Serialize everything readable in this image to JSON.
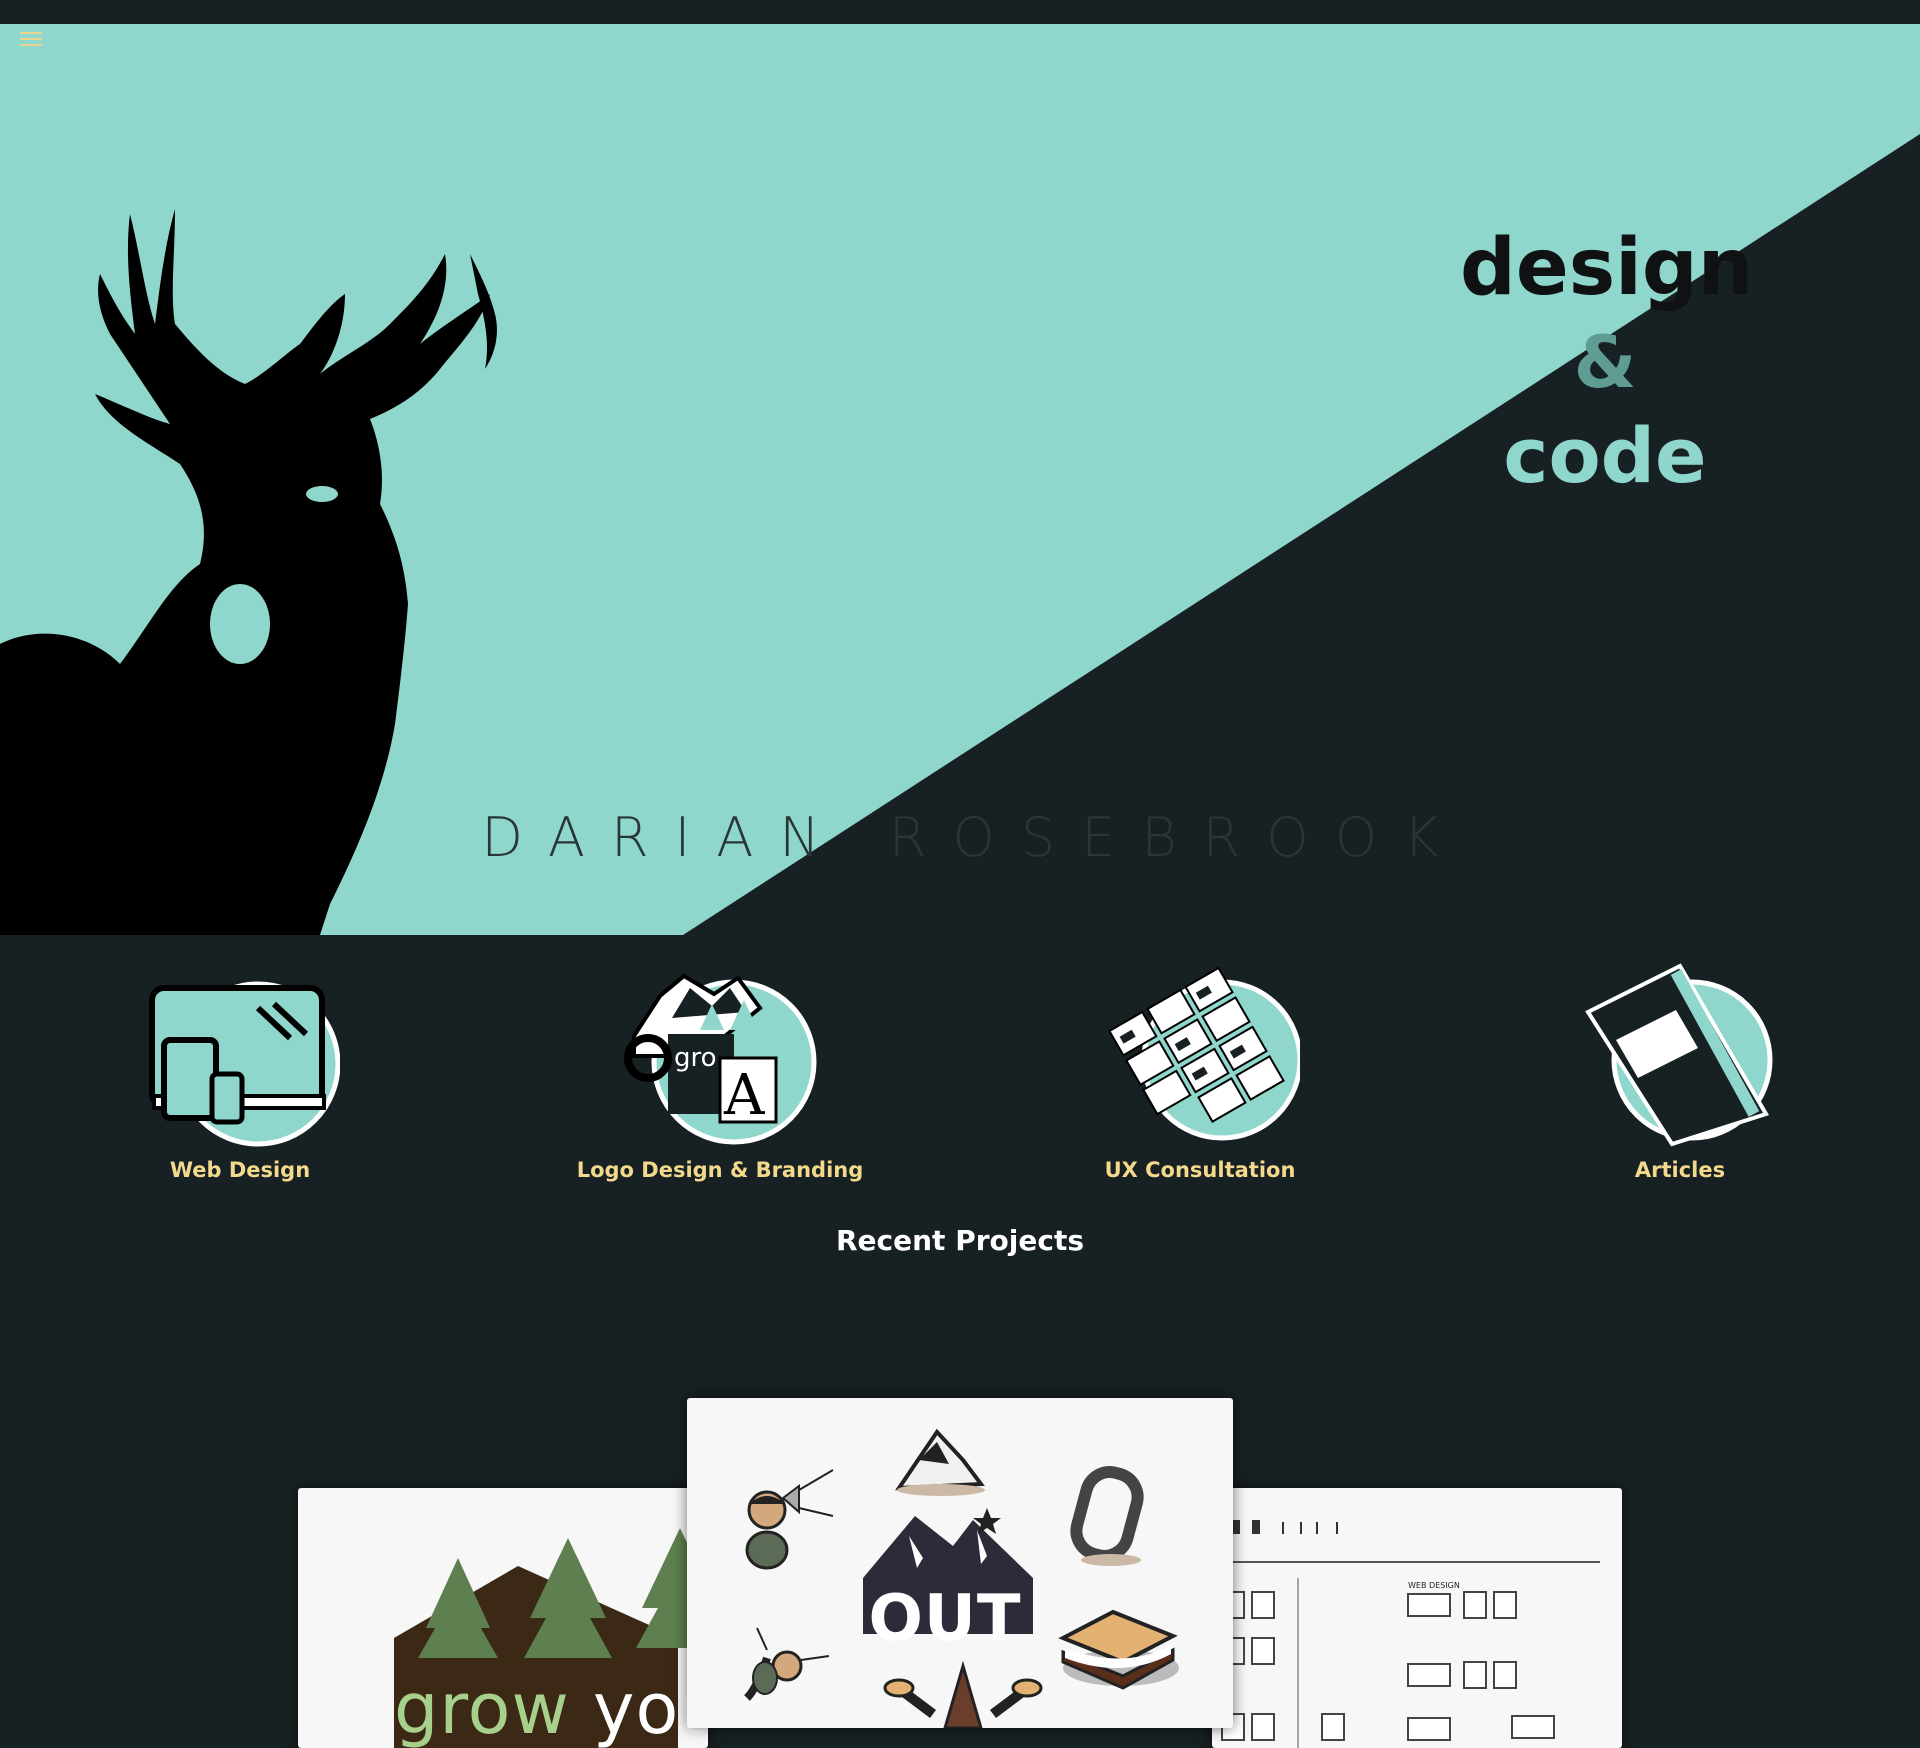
{
  "hero": {
    "tagline": {
      "line1": "design",
      "line2": "&",
      "line3": "code"
    },
    "owner_name": "DARIAN ROSEBROOK"
  },
  "services": [
    {
      "label": "Web Design"
    },
    {
      "label": "Logo Design & Branding"
    },
    {
      "label": "UX Consultation"
    },
    {
      "label": "Articles"
    }
  ],
  "recent_projects": {
    "title": "Recent Projects",
    "cards": [
      {
        "brand_text_1": "grow",
        "brand_text_2": "you"
      },
      {
        "logo_text": "OUT"
      },
      {
        "section_text": "WEB DESIGN"
      }
    ]
  },
  "colors": {
    "mint": "#8fd7cc",
    "dark": "#172022",
    "label_gold": "#f3d98b"
  }
}
